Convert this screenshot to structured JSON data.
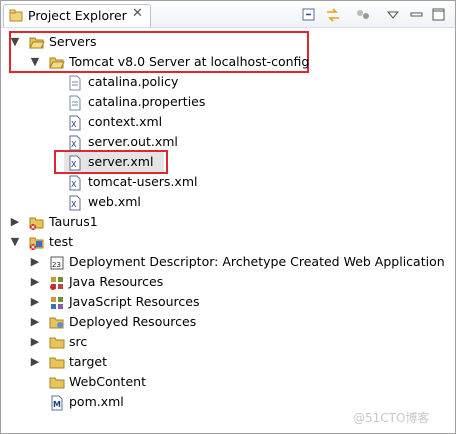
{
  "view": {
    "tab_label": "Project Explorer",
    "close_glyph": "✕",
    "toolbar": [
      "collapse-all-icon",
      "link-with-editor-icon",
      "focus-icon",
      "view-menu-icon",
      "minimize-icon",
      "maximize-icon"
    ]
  },
  "tree": {
    "servers": {
      "label": "Servers",
      "tomcat": {
        "label": "Tomcat v8.0 Server at localhost-config",
        "files": [
          "catalina.policy",
          "catalina.properties",
          "context.xml",
          "server.out.xml",
          "server.xml",
          "tomcat-users.xml",
          "web.xml"
        ]
      }
    },
    "taurus": {
      "label": "Taurus1"
    },
    "test": {
      "label": "test",
      "children": [
        "Deployment Descriptor: Archetype Created Web Application",
        "Java Resources",
        "JavaScript Resources",
        "Deployed Resources",
        "src",
        "target",
        "WebContent",
        "pom.xml"
      ]
    }
  },
  "colors": {
    "highlight": "#e0262e",
    "folder": "#e8c35a"
  },
  "watermark": "@51CTO博客"
}
